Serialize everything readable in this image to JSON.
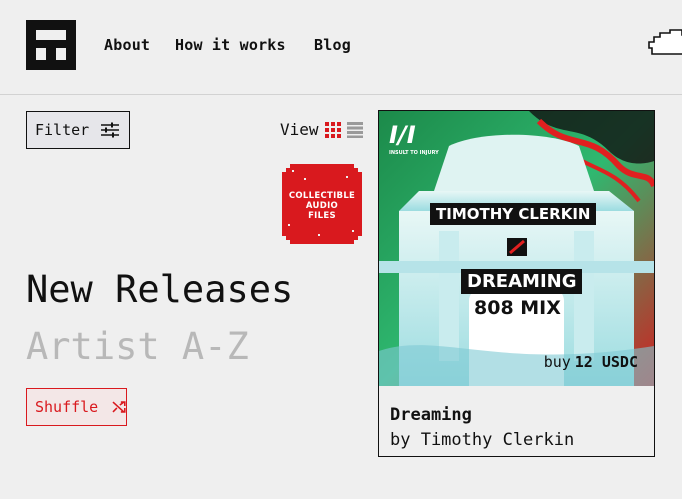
{
  "nav": {
    "about": "About",
    "how_it_works": "How it works",
    "blog": "Blog"
  },
  "filter_label": "Filter",
  "view_label": "View",
  "badge_lines": [
    "COLLECTIBLE",
    "AUDIO",
    "FILES"
  ],
  "sort": {
    "active": "New Releases",
    "inactive": "Artist A-Z"
  },
  "shuffle_label": "Shuffle",
  "release": {
    "art_logo": "I/I",
    "art_label": "INSULT TO INJURY",
    "art_artist": "TIMOTHY CLERKIN",
    "art_title": "DREAMING",
    "art_subtitle": "808 MIX",
    "buy_prefix": "buy",
    "price": "12 USDC",
    "title": "Dreaming",
    "artist": "by Timothy Clerkin"
  },
  "colors": {
    "accent": "#d9191e",
    "ink": "#111111",
    "background": "#efefef",
    "muted": "#b8b8b8"
  }
}
